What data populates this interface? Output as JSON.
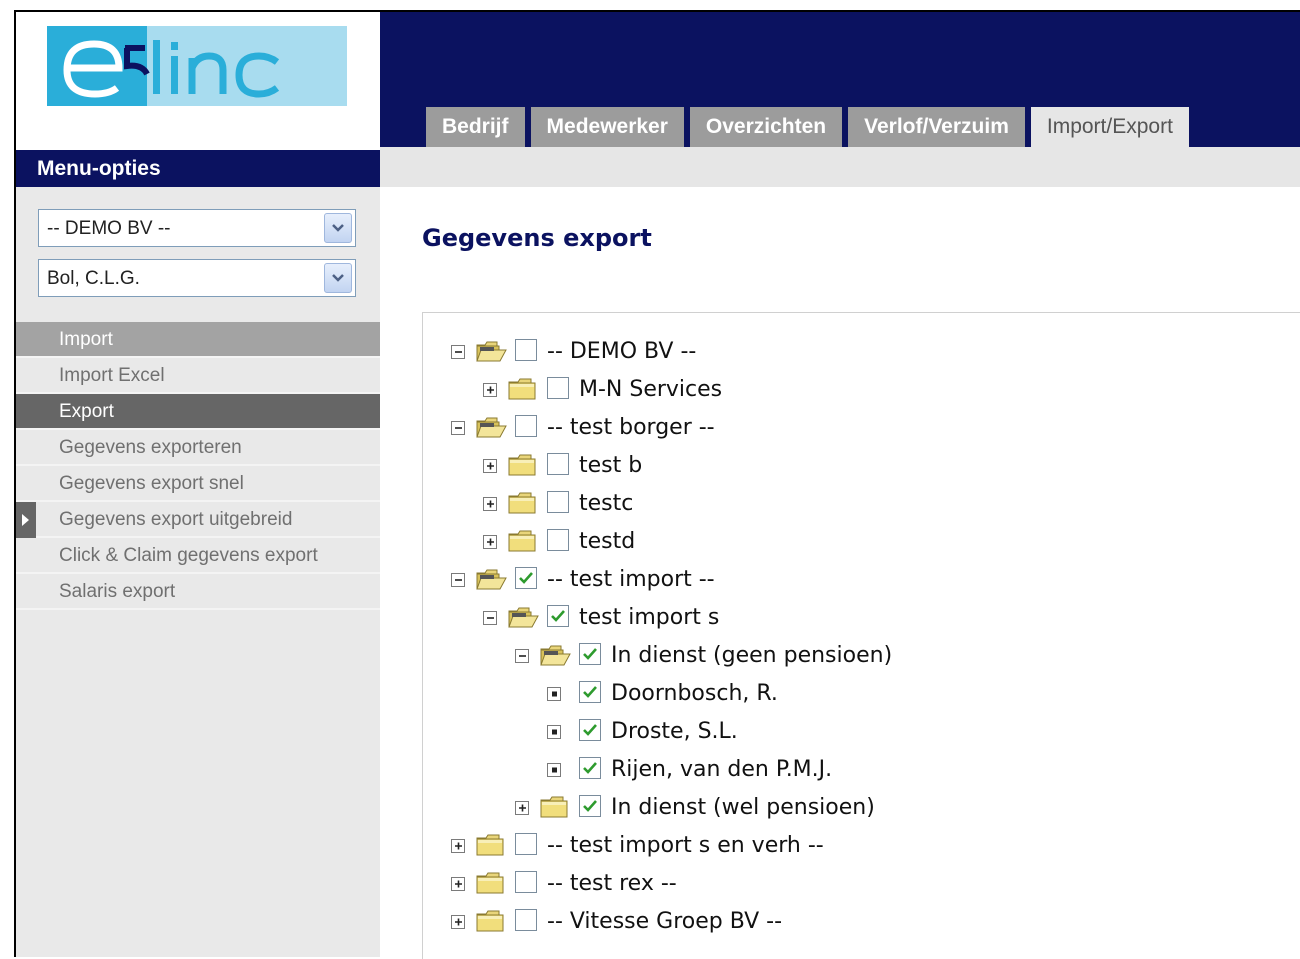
{
  "app": {
    "logo_text": "e5linc"
  },
  "sidebar": {
    "header": "Menu-opties",
    "company_select": "-- DEMO BV --",
    "employee_select": "Bol, C.L.G.",
    "nav": [
      {
        "label": "Import",
        "kind": "header"
      },
      {
        "label": "Import Excel",
        "kind": "item"
      },
      {
        "label": "Export",
        "kind": "header-active"
      },
      {
        "label": "Gegevens exporteren",
        "kind": "item"
      },
      {
        "label": "Gegevens export snel",
        "kind": "item"
      },
      {
        "label": "Gegevens export uitgebreid",
        "kind": "item-current"
      },
      {
        "label": "Click & Claim gegevens export",
        "kind": "item"
      },
      {
        "label": "Salaris export",
        "kind": "item"
      }
    ]
  },
  "tabs": [
    {
      "label": "Bedrijf",
      "active": false
    },
    {
      "label": "Medewerker",
      "active": false
    },
    {
      "label": "Overzichten",
      "active": false
    },
    {
      "label": "Verlof/Verzuim",
      "active": false
    },
    {
      "label": "Import/Export",
      "active": true
    }
  ],
  "main": {
    "title": "Gegevens export",
    "tree": [
      {
        "label": "-- DEMO BV --",
        "level": 0,
        "toggle": "minus",
        "icon": "folder-open",
        "checked": false
      },
      {
        "label": "M-N Services",
        "level": 1,
        "toggle": "plus",
        "icon": "folder-closed",
        "checked": false
      },
      {
        "label": "-- test borger --",
        "level": 0,
        "toggle": "minus",
        "icon": "folder-open",
        "checked": false
      },
      {
        "label": "test b",
        "level": 1,
        "toggle": "plus",
        "icon": "folder-closed",
        "checked": false
      },
      {
        "label": "testc",
        "level": 1,
        "toggle": "plus",
        "icon": "folder-closed",
        "checked": false
      },
      {
        "label": "testd",
        "level": 1,
        "toggle": "plus",
        "icon": "folder-closed",
        "checked": false
      },
      {
        "label": "-- test import --",
        "level": 0,
        "toggle": "minus",
        "icon": "folder-open",
        "checked": true
      },
      {
        "label": "test import s",
        "level": 1,
        "toggle": "minus",
        "icon": "folder-open",
        "checked": true
      },
      {
        "label": "In dienst (geen pensioen)",
        "level": 2,
        "toggle": "minus",
        "icon": "folder-open",
        "checked": true
      },
      {
        "label": "Doornbosch, R.",
        "level": 3,
        "toggle": "leaf",
        "icon": "none",
        "checked": true
      },
      {
        "label": "Droste, S.L.",
        "level": 3,
        "toggle": "leaf",
        "icon": "none",
        "checked": true
      },
      {
        "label": "Rijen, van den P.M.J.",
        "level": 3,
        "toggle": "leaf",
        "icon": "none",
        "checked": true
      },
      {
        "label": "In dienst (wel pensioen)",
        "level": 2,
        "toggle": "plus",
        "icon": "folder-closed",
        "checked": true
      },
      {
        "label": "-- test import s en verh --",
        "level": 0,
        "toggle": "plus",
        "icon": "folder-closed",
        "checked": false
      },
      {
        "label": "-- test rex --",
        "level": 0,
        "toggle": "plus",
        "icon": "folder-closed",
        "checked": false
      },
      {
        "label": "-- Vitesse Groep BV --",
        "level": 0,
        "toggle": "plus",
        "icon": "folder-closed",
        "checked": false
      }
    ]
  },
  "colors": {
    "navy": "#0b1260",
    "logo_blue": "#2aaed9",
    "logo_light": "#a8dcef",
    "tab_gray": "#9c9c9c",
    "checkmark": "#2e9b2e"
  }
}
